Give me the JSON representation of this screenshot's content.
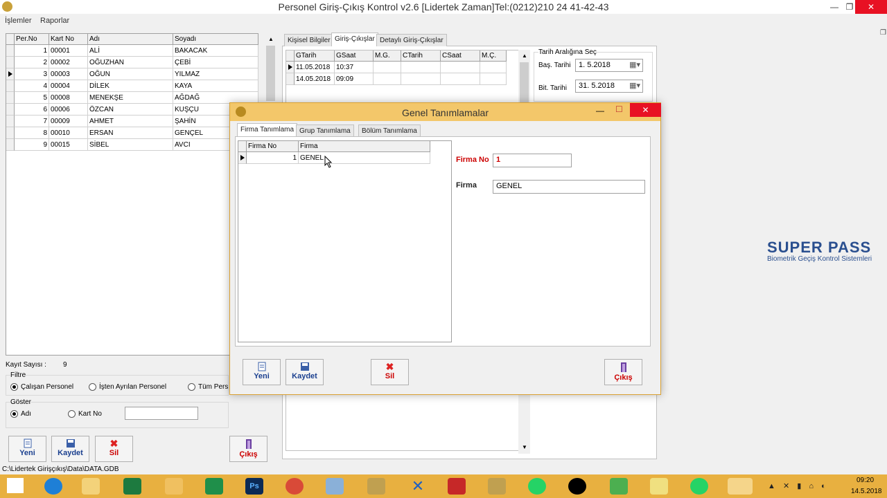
{
  "app": {
    "title": "Personel Giriş-Çıkış Kontrol v2.6 [Lidertek Zaman]Tel:(0212)210 24 41-42-43",
    "menu": [
      "İşlemler",
      "Raporlar"
    ]
  },
  "personnel_grid": {
    "headers": [
      "Per.No",
      "Kart No",
      "Adı",
      "Soyadı"
    ],
    "rows": [
      [
        "1",
        "00001",
        "ALİ",
        "BAKACAK"
      ],
      [
        "2",
        "00002",
        "OĞUZHAN",
        "ÇEBİ"
      ],
      [
        "3",
        "00003",
        "OĞUN",
        "YILMAZ"
      ],
      [
        "4",
        "00004",
        "DİLEK",
        "KAYA"
      ],
      [
        "5",
        "00008",
        "MENEKŞE",
        "AĞDAĞ"
      ],
      [
        "6",
        "00006",
        "ÖZCAN",
        "KUŞÇU"
      ],
      [
        "7",
        "00009",
        "AHMET",
        "ŞAHİN"
      ],
      [
        "8",
        "00010",
        "ERSAN",
        "GENÇEL"
      ],
      [
        "9",
        "00015",
        "SİBEL",
        "AVCI"
      ]
    ]
  },
  "left_panel": {
    "record_count_label": "Kayıt Sayısı :",
    "record_count": "9",
    "filter_label": "Filtre",
    "filter_options": [
      "Çalışan Personel",
      "İşten Ayrılan Personel",
      "Tüm Pers"
    ],
    "show_label": "Göster",
    "show_options": [
      "Adı",
      "Kart No"
    ],
    "search_value": ""
  },
  "buttons": {
    "new": "Yeni",
    "save": "Kaydet",
    "delete": "Sil",
    "exit": "Çıkış"
  },
  "right_tabs": [
    "Kişisel Bilgiler",
    "Giriş-Çıkışlar",
    "Detaylı Giriş-Çıkışlar"
  ],
  "entries_grid": {
    "headers": [
      "GTarih",
      "GSaat",
      "M.G.",
      "CTarih",
      "CSaat",
      "M.Ç."
    ],
    "rows": [
      [
        "11.05.2018",
        "10:37",
        "",
        "",
        "",
        ""
      ],
      [
        "14.05.2018",
        "09:09",
        "",
        "",
        "",
        ""
      ]
    ]
  },
  "date_range": {
    "label": "Tarih Aralığına Seç",
    "start_label": "Baş. Tarihi",
    "start_value": "1. 5.2018",
    "end_label": "Bit. Tarihi",
    "end_value": "31. 5.2018"
  },
  "brand": {
    "name": "SUPER PASS",
    "tagline": "Biometrik Geçiş Kontrol Sistemleri",
    "color": "#2a4f8f"
  },
  "dialog": {
    "title": "Genel Tanımlamalar",
    "tabs": [
      "Firma Tanımlama",
      "Grup Tanımlama",
      "Bölüm Tanımlama"
    ],
    "grid_headers": [
      "Firma No",
      "Firma"
    ],
    "grid_rows": [
      [
        "1",
        "GENEL"
      ]
    ],
    "firma_no_label": "Firma No",
    "firma_no_value": "1",
    "firma_label": "Firma",
    "firma_value": "GENEL"
  },
  "status_path": "C:\\Lidertek Girişçıkış\\Data\\DATA.GDB",
  "clock": {
    "time": "09:20",
    "date": "14.5.2018"
  }
}
